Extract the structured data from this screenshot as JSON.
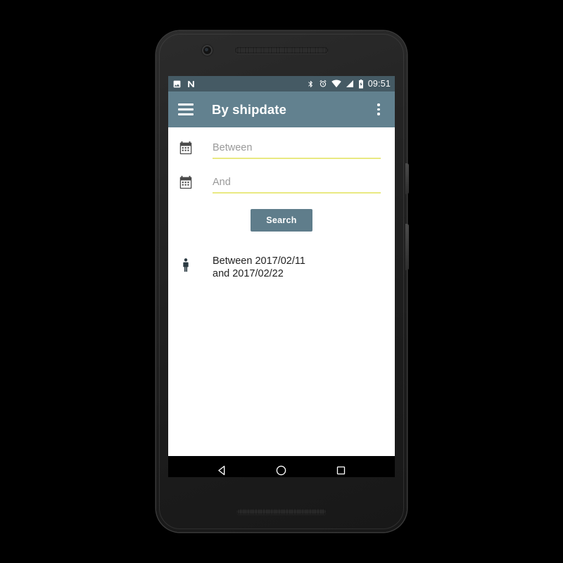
{
  "device": {
    "name": "android-phone",
    "camera_icon": "camera-lens-icon",
    "earpiece_icon": "earpiece-speaker-grille",
    "bottom_speaker_icon": "bottom-speaker-grille",
    "power_button_label": "Power",
    "volume_button_label": "Volume"
  },
  "colors": {
    "status_bar": "#455A64",
    "app_bar": "#62818F",
    "accent_underline": "#E9E982",
    "button_background": "#5F7D8B",
    "content_background": "#FFFFFF",
    "nav_bar": "#000000"
  },
  "status_bar": {
    "left_icons": [
      "image-icon",
      "android-n-icon"
    ],
    "right_icons": [
      "bluetooth-icon",
      "alarm-icon",
      "wifi-icon",
      "signal-icon",
      "battery-icon"
    ],
    "clock": "09:51"
  },
  "app_bar": {
    "menu_icon": "hamburger-menu-icon",
    "title": "By shipdate",
    "overflow_icon": "overflow-menu-icon"
  },
  "form": {
    "fields": [
      {
        "icon": "calendar-icon",
        "name": "between-date",
        "placeholder": "Between",
        "value": ""
      },
      {
        "icon": "calendar-icon",
        "name": "and-date",
        "placeholder": "And",
        "value": ""
      }
    ],
    "search_button_label": "Search"
  },
  "result": {
    "icon": "person-icon",
    "text": "Between 2017/02/11 and 2017/02/22"
  },
  "nav_bar": {
    "back_label": "Back",
    "home_label": "Home",
    "recents_label": "Recent apps"
  }
}
